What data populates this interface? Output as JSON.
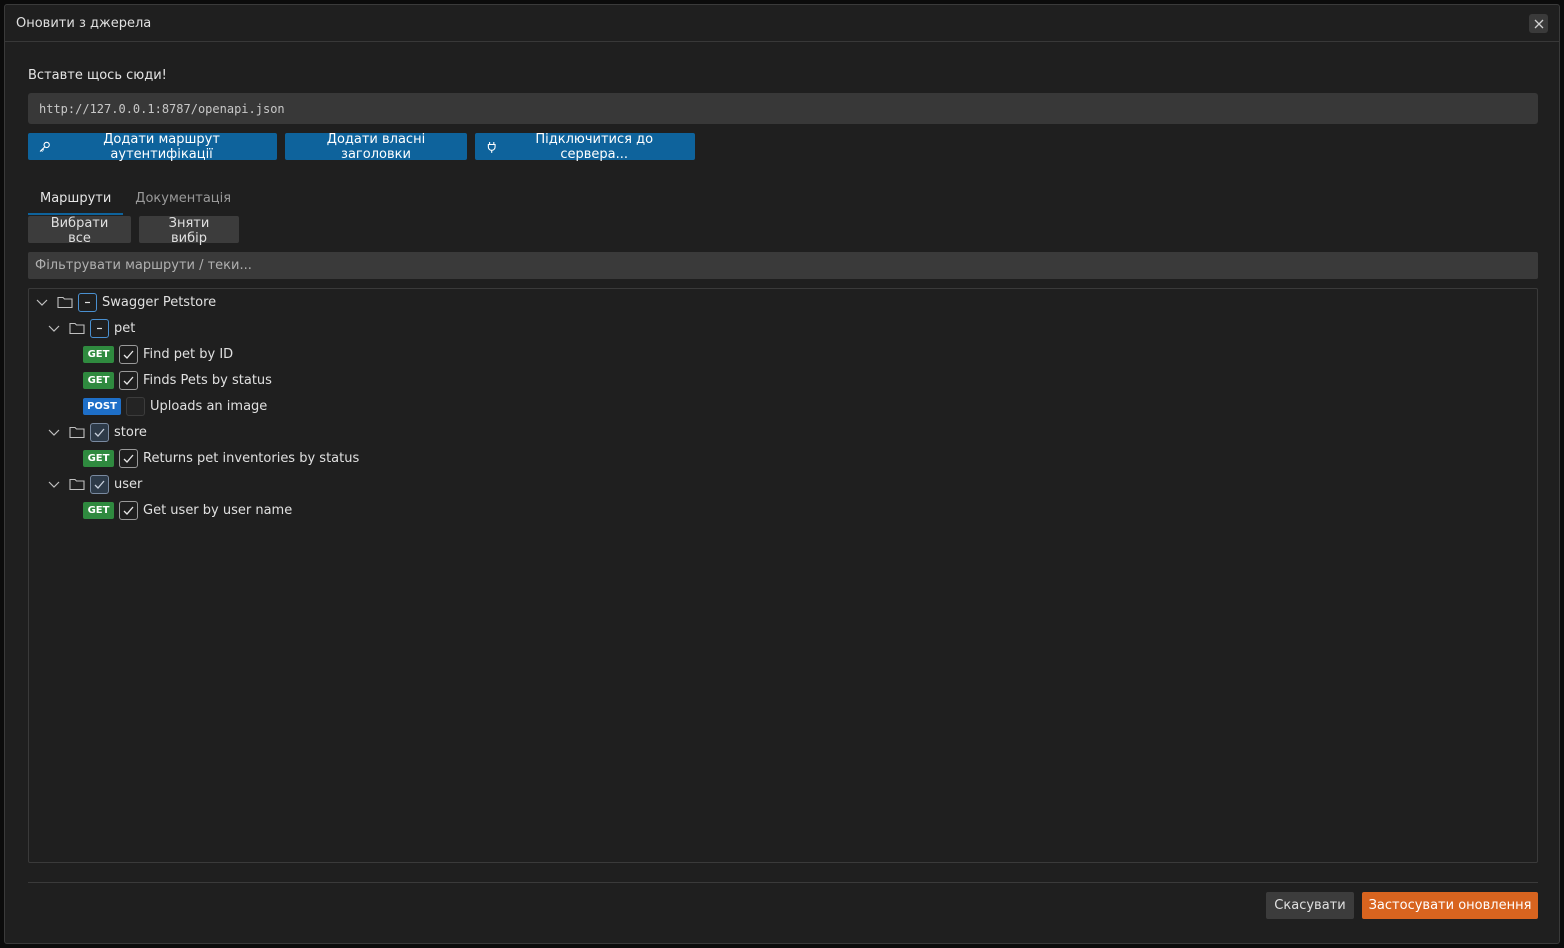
{
  "dialog": {
    "title": "Оновити з джерела",
    "close_icon": "close-icon"
  },
  "source": {
    "label": "Вставте щось сюди!",
    "url_value": "http://127.0.0.1:8787/openapi.json"
  },
  "actions": {
    "add_auth_route": "Додати маршрут аутентифікації",
    "add_headers": "Додати власні заголовки",
    "connect_server": "Підключитися до сервера..."
  },
  "tabs": [
    {
      "label": "Маршрути",
      "active": true
    },
    {
      "label": "Документація",
      "active": false
    }
  ],
  "selection": {
    "select_all": "Вибрати все",
    "deselect": "Зняти вибір"
  },
  "filter": {
    "placeholder": "Фільтрувати маршрути / теки..."
  },
  "tree": {
    "root": {
      "label": "Swagger Petstore",
      "state": "mixed"
    },
    "folders": [
      {
        "label": "pet",
        "state": "mixed",
        "routes": [
          {
            "method": "GET",
            "label": "Find pet by ID",
            "checked": true
          },
          {
            "method": "GET",
            "label": "Finds Pets by status",
            "checked": true
          },
          {
            "method": "POST",
            "label": "Uploads an image",
            "checked": false
          }
        ]
      },
      {
        "label": "store",
        "state": "checked",
        "routes": [
          {
            "method": "GET",
            "label": "Returns pet inventories by status",
            "checked": true
          }
        ]
      },
      {
        "label": "user",
        "state": "checked",
        "routes": [
          {
            "method": "GET",
            "label": "Get user by user name",
            "checked": true
          }
        ]
      }
    ]
  },
  "footer": {
    "cancel": "Скасувати",
    "apply": "Застосувати оновлення"
  },
  "colors": {
    "primary": "#0e639c",
    "apply": "#d8641f",
    "get_badge": "#2f8a3f",
    "post_badge": "#1e6fc8"
  }
}
